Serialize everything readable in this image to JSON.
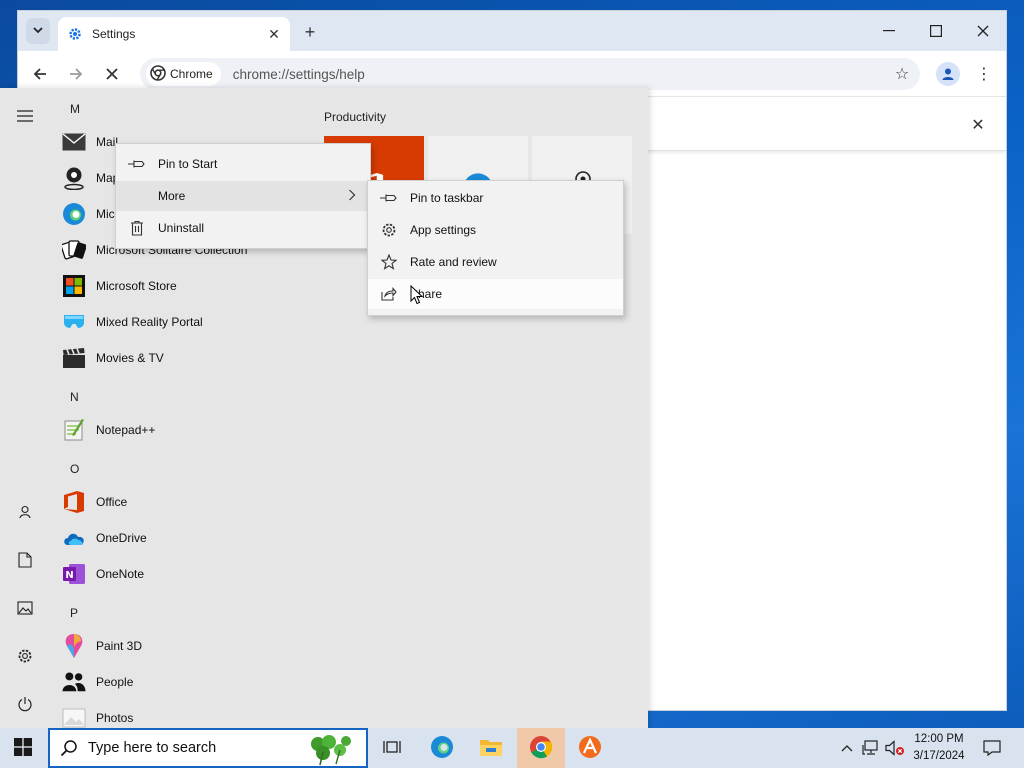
{
  "browser": {
    "tab_title": "Settings",
    "chip_label": "Chrome",
    "url": "chrome://settings/help"
  },
  "start_menu": {
    "letters": {
      "m": "M",
      "n": "N",
      "o": "O",
      "p": "P"
    },
    "apps": {
      "mail": "Mail",
      "maps": "Maps",
      "edge": "Microsoft Edge",
      "solitaire": "Microsoft Solitaire Collection",
      "store": "Microsoft Store",
      "mixed_reality": "Mixed Reality Portal",
      "movies": "Movies & TV",
      "notepadpp": "Notepad++",
      "office": "Office",
      "onedrive": "OneDrive",
      "onenote": "OneNote",
      "paint3d": "Paint 3D",
      "people": "People",
      "photos": "Photos"
    },
    "group_title": "Productivity"
  },
  "context_menu": {
    "pin_to_start": "Pin to Start",
    "more": "More",
    "uninstall": "Uninstall"
  },
  "submenu": {
    "pin_to_taskbar": "Pin to taskbar",
    "app_settings": "App settings",
    "rate_and_review": "Rate and review",
    "share": "Share"
  },
  "taskbar": {
    "search_placeholder": "Type here to search",
    "time": "12:00 PM",
    "date": "3/17/2024"
  },
  "colors": {
    "office_red": "#d83b01",
    "taskbar_bg": "#d9e3ef",
    "search_border": "#1565c0",
    "chrome_active": "#f0c9a8"
  }
}
